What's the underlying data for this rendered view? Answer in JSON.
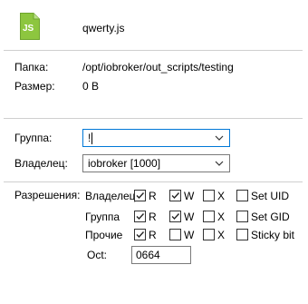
{
  "file": {
    "icon": "js-file-icon",
    "icon_text": "JS",
    "name": "qwerty.js",
    "accent_color": "#8dc63f"
  },
  "info": {
    "folder_label": "Папка:",
    "folder_value": "/opt/iobroker/out_scripts/testing",
    "size_label": "Размер:",
    "size_value": "0 B"
  },
  "ownership": {
    "group_label": "Группа:",
    "group_value": "!",
    "owner_label": "Владелец:",
    "owner_value": "iobroker [1000]"
  },
  "permissions": {
    "label": "Разрешения:",
    "rows": [
      {
        "name": "Владелец",
        "R": true,
        "W": true,
        "X": false,
        "special": "Set UID",
        "special_checked": false
      },
      {
        "name": "Группа",
        "R": true,
        "W": true,
        "X": false,
        "special": "Set GID",
        "special_checked": false
      },
      {
        "name": "Прочие",
        "R": true,
        "W": false,
        "X": false,
        "special": "Sticky bit",
        "special_checked": false
      }
    ],
    "r_label": "R",
    "w_label": "W",
    "x_label": "X",
    "oct_label": "Oct:",
    "oct_value": "0664"
  }
}
